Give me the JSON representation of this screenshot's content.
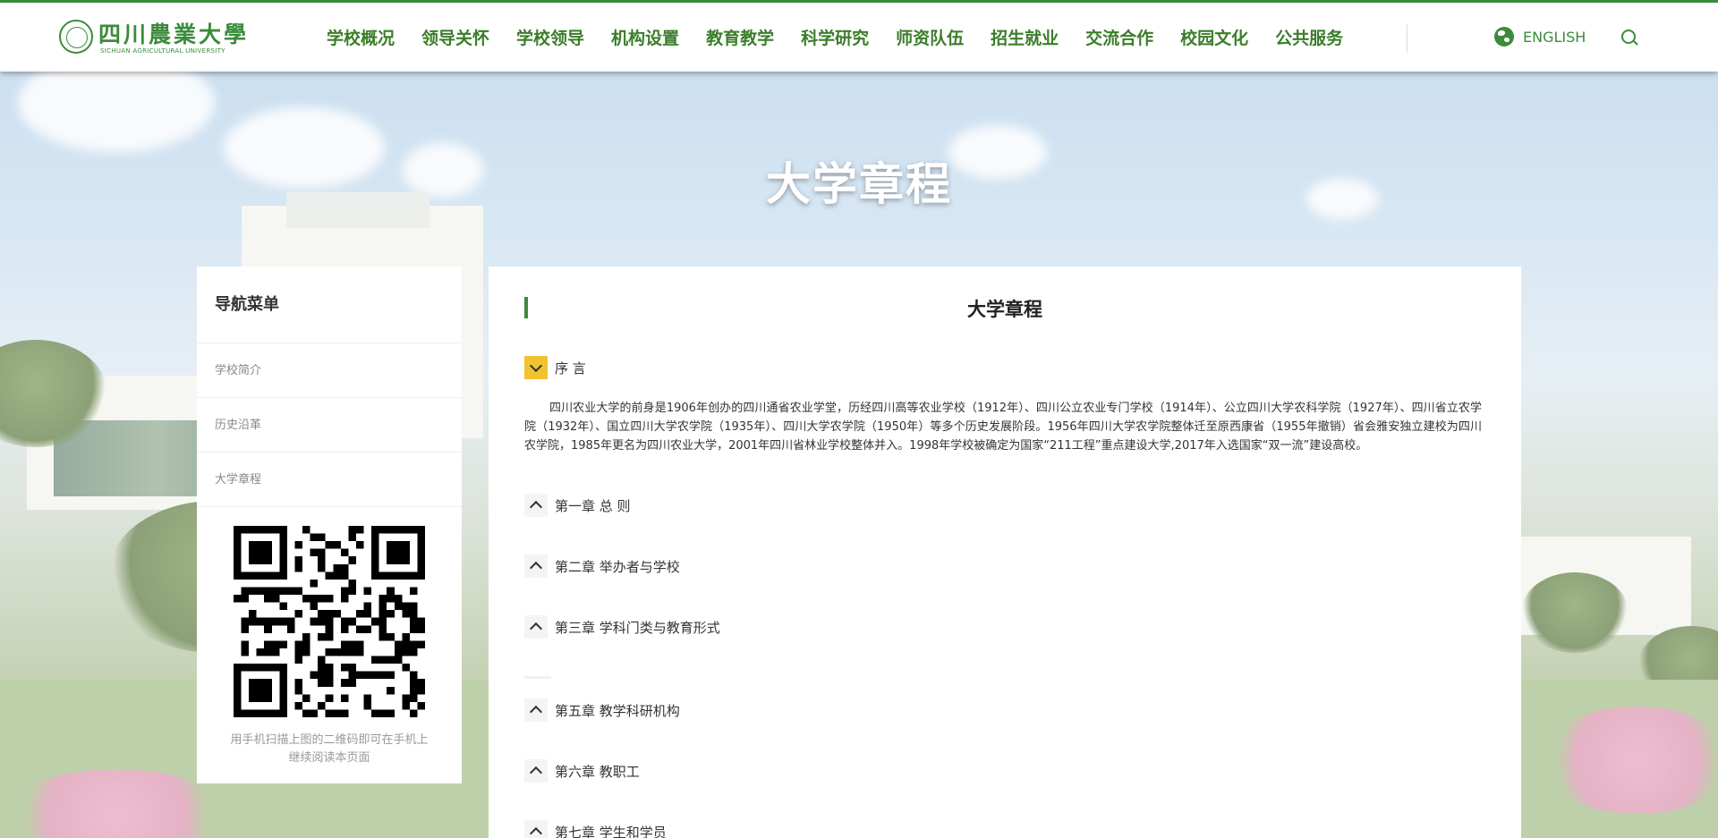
{
  "header": {
    "logo_cn": "四川農業大學",
    "logo_en": "SICHUAN AGRICULTURAL UNIVERSITY",
    "nav": [
      "学校概况",
      "领导关怀",
      "学校领导",
      "机构设置",
      "教育教学",
      "科学研究",
      "师资队伍",
      "招生就业",
      "交流合作",
      "校园文化",
      "公共服务"
    ],
    "language_label": "ENGLISH"
  },
  "banner": {
    "title": "大学章程"
  },
  "sidebar": {
    "title": "导航菜单",
    "items": [
      "学校简介",
      "历史沿革",
      "大学章程"
    ],
    "qr_caption": "用手机扫描上图的二维码即可在手机上继续阅读本页面"
  },
  "main": {
    "title": "大学章程",
    "preface": {
      "label": "序 言",
      "text": "四川农业大学的前身是1906年创办的四川通省农业学堂，历经四川高等农业学校（1912年）、四川公立农业专门学校（1914年）、公立四川大学农科学院（1927年）、四川省立农学院（1932年）、国立四川大学农学院（1935年）、四川大学农学院（1950年）等多个历史发展阶段。1956年四川大学农学院整体迁至原西康省（1955年撤销）省会雅安独立建校为四川农学院，1985年更名为四川农业大学，2001年四川省林业学校整体并入。1998年学校被确定为国家“211工程”重点建设大学,2017年入选国家“双一流”建设高校。"
    },
    "chapters": [
      "第一章 总 则",
      "第二章 举办者与学校",
      "第三章 学科门类与教育形式",
      "第五章 教学科研机构",
      "第六章 教职工",
      "第七章 学生和学员"
    ]
  },
  "colors": {
    "brand_green": "#3b8b3b",
    "accent_yellow": "#f0c330"
  }
}
